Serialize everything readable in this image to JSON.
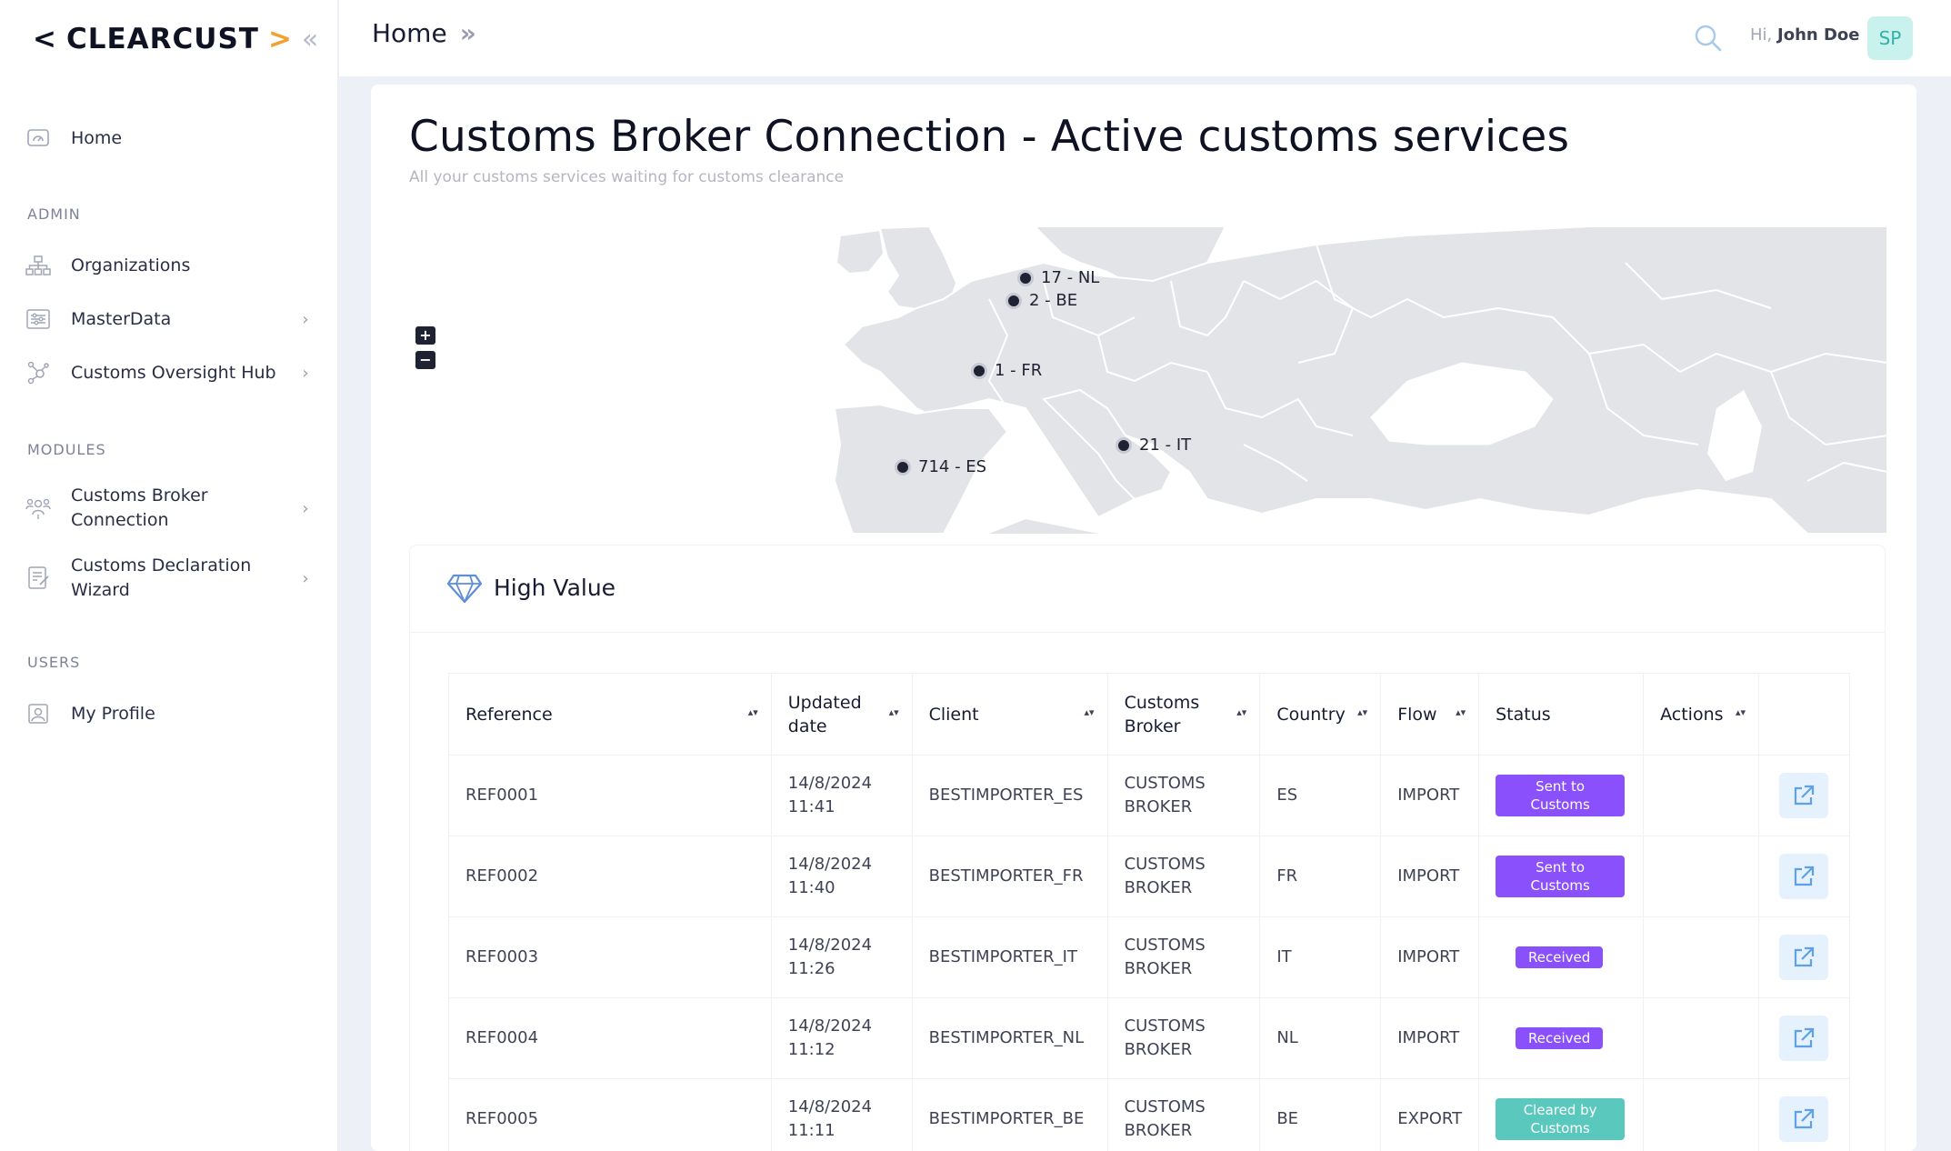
{
  "app": {
    "logo_left": "<",
    "logo_text": "CLEARCUST",
    "logo_right": ">",
    "collapse_glyph": "«"
  },
  "sidebar": {
    "home": "Home",
    "sections": {
      "admin": "ADMIN",
      "modules": "MODULES",
      "users": "USERS"
    },
    "items": {
      "organizations": "Organizations",
      "masterdata": "MasterData",
      "oversight": "Customs Oversight Hub",
      "broker_line1": "Customs Broker",
      "broker_line2": "Connection",
      "wizard_line1": "Customs Declaration",
      "wizard_line2": "Wizard",
      "profile": "My Profile"
    }
  },
  "topbar": {
    "breadcrumb": "Home",
    "greeting": "Hi,",
    "user_name": "John Doe",
    "avatar_initials": "SP"
  },
  "page": {
    "title": "Customs Broker Connection - Active customs services",
    "subtitle": "All your customs services waiting for customs clearance"
  },
  "map": {
    "zoom_in": "+",
    "zoom_out": "−",
    "markers": {
      "nl": "17 - NL",
      "be": "2 - BE",
      "fr": "1 - FR",
      "it": "21 - IT",
      "es": "714 - ES"
    }
  },
  "high_value": {
    "title": "High Value",
    "columns": {
      "reference": "Reference",
      "updated_line1": "Updated",
      "updated_line2": "date",
      "client": "Client",
      "broker_line1": "Customs",
      "broker_line2": "Broker",
      "country": "Country",
      "flow": "Flow",
      "status": "Status",
      "actions": "Actions"
    },
    "rows": [
      {
        "reference": "REF0001",
        "date": "14/8/2024",
        "time": "11:41",
        "client": "BESTIMPORTER_ES",
        "broker1": "CUSTOMS",
        "broker2": "BROKER",
        "country": "ES",
        "flow": "IMPORT",
        "status1": "Sent to",
        "status2": "Customs"
      },
      {
        "reference": "REF0002",
        "date": "14/8/2024",
        "time": "11:40",
        "client": "BESTIMPORTER_FR",
        "broker1": "CUSTOMS",
        "broker2": "BROKER",
        "country": "FR",
        "flow": "IMPORT",
        "status1": "Sent to",
        "status2": "Customs"
      },
      {
        "reference": "REF0003",
        "date": "14/8/2024",
        "time": "11:26",
        "client": "BESTIMPORTER_IT",
        "broker1": "CUSTOMS",
        "broker2": "BROKER",
        "country": "IT",
        "flow": "IMPORT",
        "status1": "Received",
        "status2": ""
      },
      {
        "reference": "REF0004",
        "date": "14/8/2024",
        "time": "11:12",
        "client": "BESTIMPORTER_NL",
        "broker1": "CUSTOMS",
        "broker2": "BROKER",
        "country": "NL",
        "flow": "IMPORT",
        "status1": "Received",
        "status2": ""
      },
      {
        "reference": "REF0005",
        "date": "14/8/2024",
        "time": "11:11",
        "client": "BESTIMPORTER_BE",
        "broker1": "CUSTOMS",
        "broker2": "BROKER",
        "country": "BE",
        "flow": "EXPORT",
        "status1": "Cleared by",
        "status2": "Customs"
      }
    ]
  },
  "colors": {
    "accent_orange": "#f0a132",
    "badge_purple": "#8950fc",
    "badge_teal": "#5bc8bd",
    "avatar_bg": "#c9f1ee",
    "map_land": "#e3e4e8"
  },
  "icons": [
    "dashboard-icon",
    "sitemap-icon",
    "sliders-icon",
    "hub-icon",
    "users-network-icon",
    "checklist-icon",
    "id-card-icon",
    "search-icon",
    "gem-icon",
    "external-link-icon",
    "chevron-right-icon"
  ]
}
